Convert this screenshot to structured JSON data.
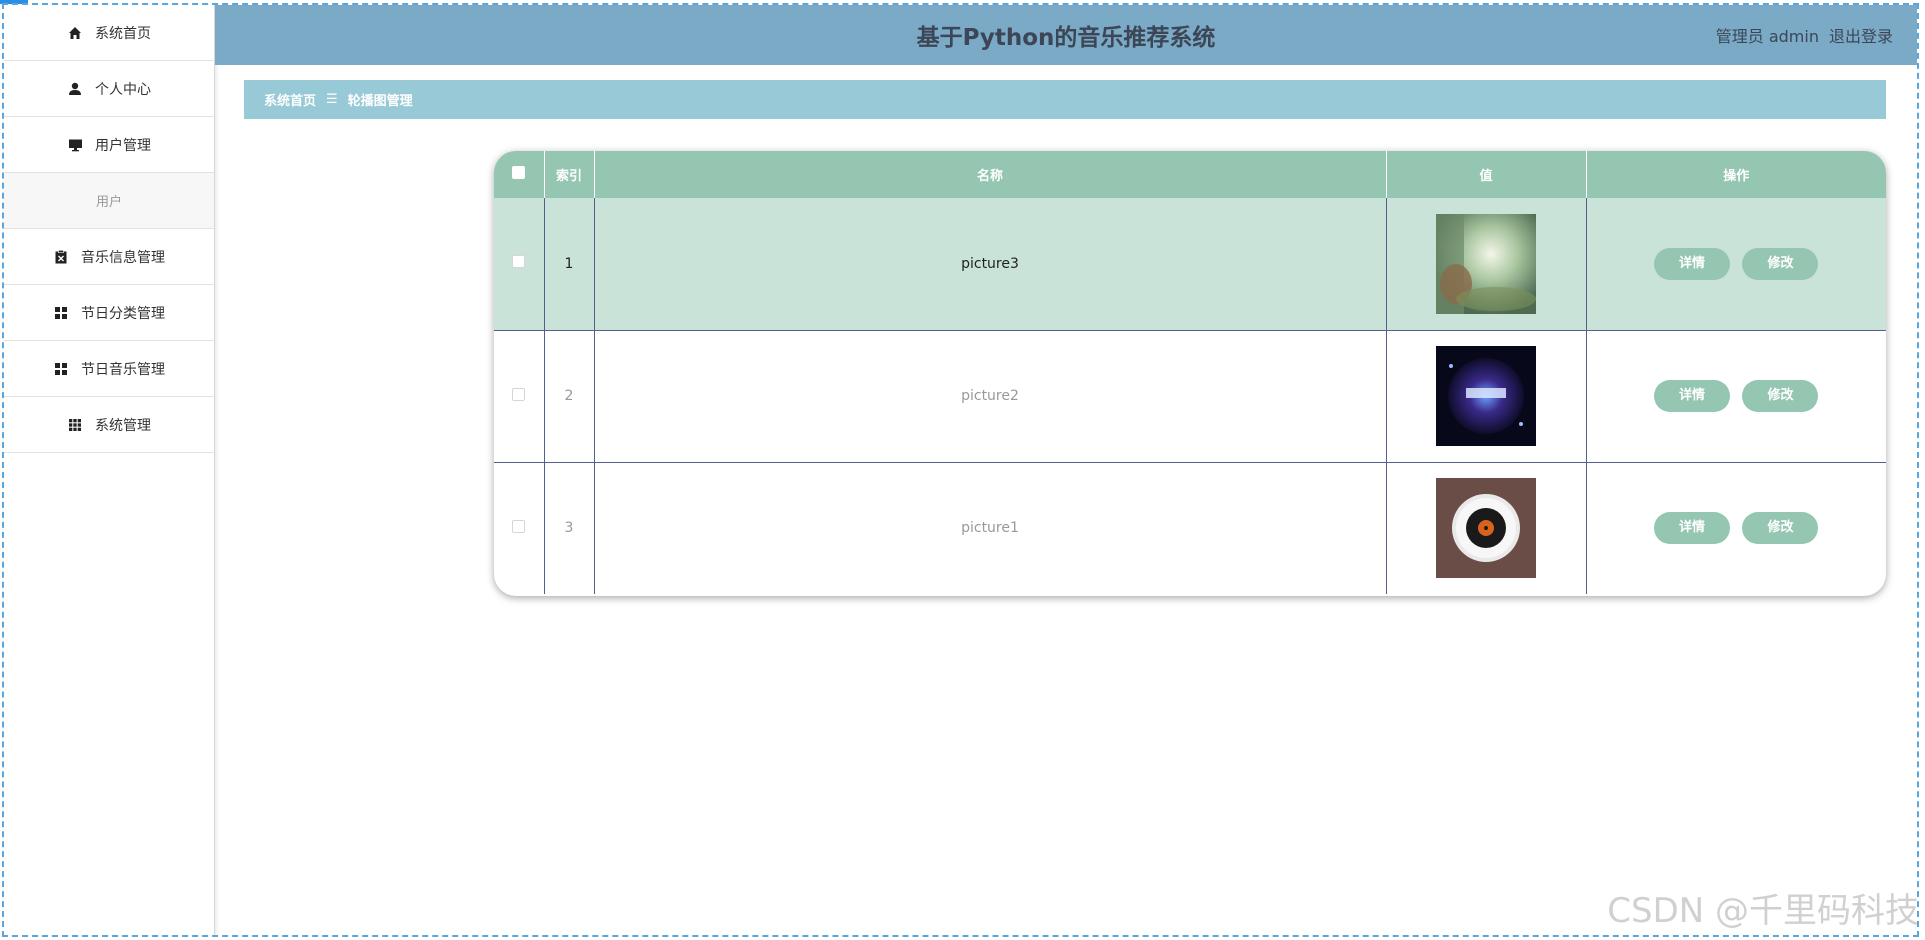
{
  "sidebar": {
    "items": [
      {
        "label": "系统首页",
        "icon": "home-icon"
      },
      {
        "label": "个人中心",
        "icon": "user-icon"
      },
      {
        "label": "用户管理",
        "icon": "monitor-icon"
      },
      {
        "label": "用户",
        "icon": ""
      },
      {
        "label": "音乐信息管理",
        "icon": "clipboard-icon"
      },
      {
        "label": "节日分类管理",
        "icon": "grid-icon"
      },
      {
        "label": "节日音乐管理",
        "icon": "grid-icon"
      },
      {
        "label": "系统管理",
        "icon": "apps-icon"
      }
    ]
  },
  "header": {
    "title": "基于Python的音乐推荐系统",
    "user_label": "管理员 admin",
    "logout_label": "退出登录"
  },
  "breadcrumb": {
    "home": "系统首页",
    "separator": "☰",
    "current": "轮播图管理"
  },
  "table": {
    "headers": [
      "索引",
      "名称",
      "值",
      "操作"
    ],
    "rows": [
      {
        "index": "1",
        "name": "picture3",
        "thumb": "thumb-forest"
      },
      {
        "index": "2",
        "name": "picture2",
        "thumb": "thumb-dark"
      },
      {
        "index": "3",
        "name": "picture1",
        "thumb": "thumb-disc"
      }
    ],
    "detail_label": "详情",
    "edit_label": "修改"
  },
  "watermark": "CSDN @千里码科技",
  "colors": {
    "header_bg": "#7aaac5",
    "breadcrumb_bg": "#98c9d6",
    "table_accent": "#94c6b2",
    "row_active": "#c9e3d8"
  }
}
